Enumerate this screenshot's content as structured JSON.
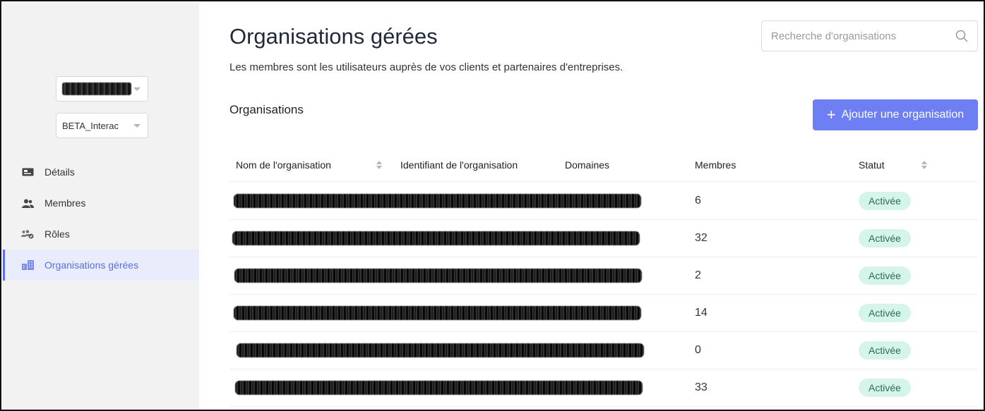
{
  "sidebar": {
    "selects": [
      {
        "value": "",
        "redacted": true
      },
      {
        "value": "BETA_Interac"
      }
    ],
    "nav": [
      {
        "label": "Détails",
        "icon": "id-card-icon",
        "active": false
      },
      {
        "label": "Membres",
        "icon": "users-icon",
        "active": false
      },
      {
        "label": "Rôles",
        "icon": "roles-icon",
        "active": false
      },
      {
        "label": "Organisations gérées",
        "icon": "building-icon",
        "active": true
      }
    ]
  },
  "main": {
    "title": "Organisations gérées",
    "subtitle": "Les membres sont les utilisateurs auprès de vos clients et partenaires d'entreprises.",
    "search": {
      "placeholder": "Recherche d'organisations",
      "value": ""
    },
    "section_title": "Organisations",
    "add_button": {
      "label": "Ajouter une organisation"
    },
    "table": {
      "columns": [
        "Nom de l'organisation",
        "Identifiant de l'organisation",
        "Domaines",
        "Membres",
        "Statut"
      ],
      "rows": [
        {
          "name_redacted": true,
          "members": "6",
          "status": "Activée"
        },
        {
          "name_redacted": true,
          "members": "32",
          "status": "Activée"
        },
        {
          "name_redacted": true,
          "members": "2",
          "status": "Activée"
        },
        {
          "name_redacted": true,
          "members": "14",
          "status": "Activée"
        },
        {
          "name_redacted": true,
          "members": "0",
          "status": "Activée"
        },
        {
          "name_redacted": true,
          "members": "33",
          "status": "Activée"
        }
      ]
    }
  },
  "colors": {
    "accent": "#6e7ff3",
    "active_nav_bg": "#e8ecfb",
    "active_nav_text": "#5b6cf0",
    "badge_bg": "#d6f5ea",
    "badge_text": "#2c6b57",
    "sidebar_bg": "#f2f2f3"
  }
}
